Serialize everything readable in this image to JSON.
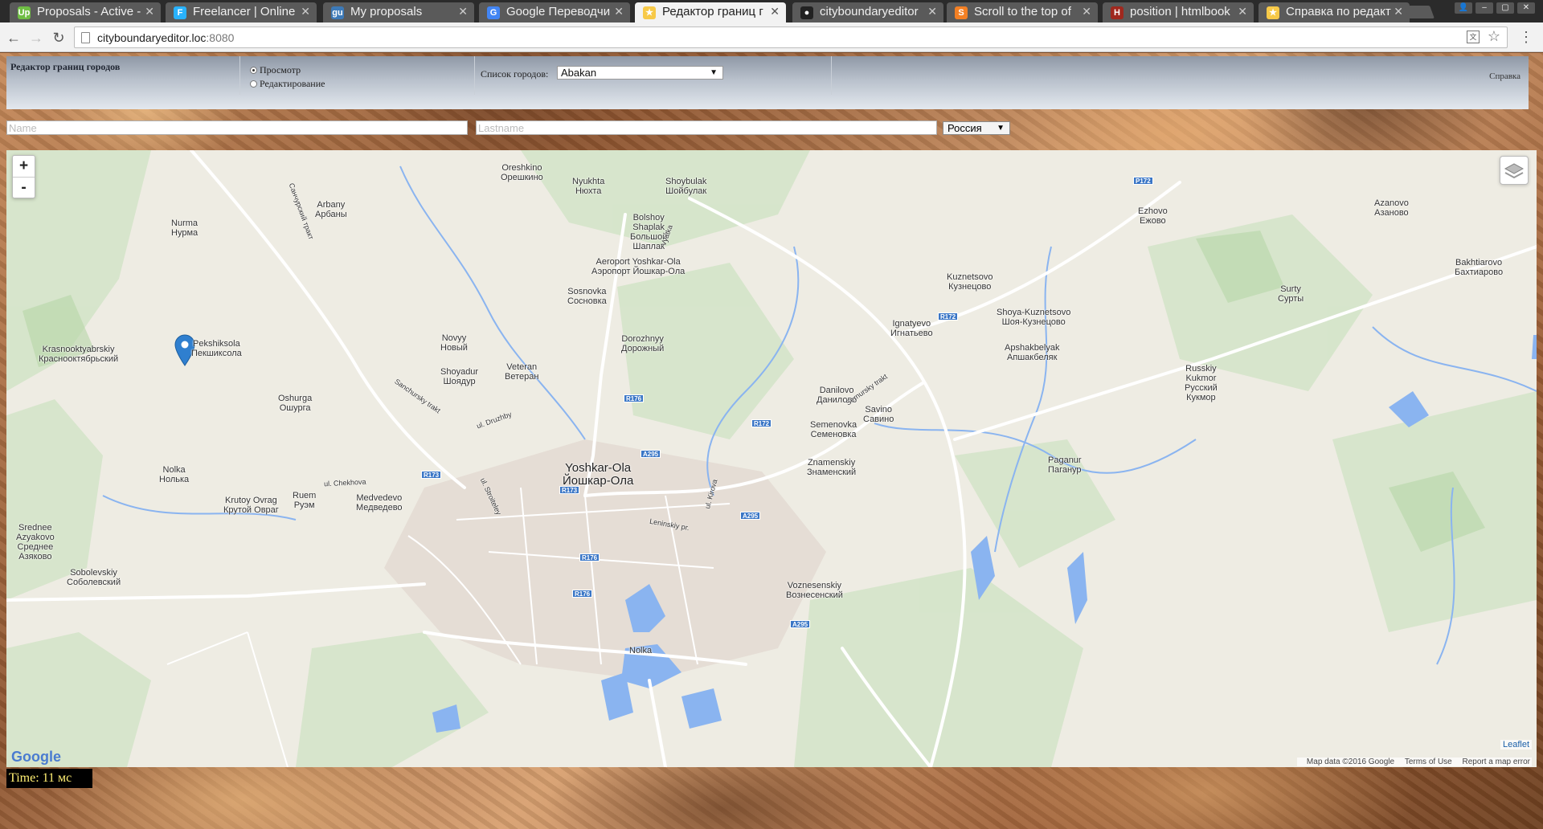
{
  "browser": {
    "tabs": [
      {
        "title": "Proposals - Active -",
        "icon": "upwork-icon",
        "color": "#6fbe44",
        "glyph": "Up"
      },
      {
        "title": "Freelancer | Online",
        "icon": "freelancer-icon",
        "color": "#29b2fe",
        "glyph": "F"
      },
      {
        "title": "My proposals",
        "icon": "guru-icon",
        "color": "#3d7ab8",
        "glyph": "gu"
      },
      {
        "title": "Google Переводчи",
        "icon": "google-translate-icon",
        "color": "#4285f4",
        "glyph": "G"
      },
      {
        "title": "Редактор границ г",
        "icon": "page-star-icon",
        "color": "#f7c948",
        "glyph": "★"
      },
      {
        "title": "cityboundaryeditor",
        "icon": "github-icon",
        "color": "#222222",
        "glyph": "●"
      },
      {
        "title": "Scroll to the top of",
        "icon": "stackoverflow-icon",
        "color": "#f48024",
        "glyph": "S"
      },
      {
        "title": "position | htmlbook",
        "icon": "htmlbook-icon",
        "color": "#a0281e",
        "glyph": "H"
      },
      {
        "title": "Справка по редакт",
        "icon": "page-star-icon",
        "color": "#f7c948",
        "glyph": "★"
      }
    ],
    "active_tab": 4,
    "url_host": "cityboundaryeditor.loc",
    "url_port": ":8080"
  },
  "header": {
    "title": "Редактор границ городов",
    "mode_view": "Просмотр",
    "mode_edit": "Редактирование",
    "city_list_label": "Список городов:",
    "city_selected": "Abakan",
    "help": "Справка"
  },
  "filters": {
    "name_placeholder": "Name",
    "lastname_placeholder": "Lastname",
    "country_selected": "Россия"
  },
  "map": {
    "zoom_in": "+",
    "zoom_out": "-",
    "labels": [
      {
        "t": "Oreshkino\nОрешкино",
        "cls": ""
      },
      {
        "t": "Nyukhta\nНюхта",
        "cls": ""
      },
      {
        "t": "Shoybulak\nШойбулак",
        "cls": ""
      },
      {
        "t": "Arbany\nАрбаны",
        "cls": ""
      },
      {
        "t": "Nurma\nНурма",
        "cls": ""
      },
      {
        "t": "Bolshoy\nShaplak\nБольшой\nШаплак",
        "cls": ""
      },
      {
        "t": "Aeroport Yoshkar-Ola\nАэропорт Йошкар-Ола",
        "cls": ""
      },
      {
        "t": "Sosnovka\nСосновка",
        "cls": ""
      },
      {
        "t": "Pekshiksola\nПекшиксола",
        "cls": ""
      },
      {
        "t": "Krasnooktyabrskiy\nКраснооктябрьский",
        "cls": ""
      },
      {
        "t": "Novyy\nНовый",
        "cls": ""
      },
      {
        "t": "Dorozhnyy\nДорожный",
        "cls": ""
      },
      {
        "t": "Veteran\nВетеран",
        "cls": ""
      },
      {
        "t": "Shoyadur\nШоядур",
        "cls": ""
      },
      {
        "t": "Oshurga\nОшурга",
        "cls": ""
      },
      {
        "t": "Yoshkar-Ola\nЙошкар-Ола",
        "cls": "big"
      },
      {
        "t": "Nolka\nНолька",
        "cls": ""
      },
      {
        "t": "Krutoy Ovrag\nКрутой Овраг",
        "cls": ""
      },
      {
        "t": "Ruem\nРуэм",
        "cls": ""
      },
      {
        "t": "Medvedevo\nМедведево",
        "cls": ""
      },
      {
        "t": "Srednee\nAzyakovo\nСреднее\nАзяково",
        "cls": ""
      },
      {
        "t": "Sobolevskiy\nСоболевский",
        "cls": ""
      },
      {
        "t": "Nolka",
        "cls": ""
      },
      {
        "t": "Ezhovo\nЕжово",
        "cls": ""
      },
      {
        "t": "Azanovo\nАзаново",
        "cls": ""
      },
      {
        "t": "Kuznetsovo\nКузнецово",
        "cls": ""
      },
      {
        "t": "Bakhtiarovo\nБахтиарово",
        "cls": ""
      },
      {
        "t": "Surty\nСурты",
        "cls": ""
      },
      {
        "t": "Ignatyevo\nИгнатьево",
        "cls": ""
      },
      {
        "t": "Shoya-Kuznetsovo\nШоя-Кузнецово",
        "cls": ""
      },
      {
        "t": "Apshakbelyak\nАпшакбеляк",
        "cls": ""
      },
      {
        "t": "Russkiy\nKukmor\nРусский\nКукмор",
        "cls": ""
      },
      {
        "t": "Danilovo\nДанилово",
        "cls": ""
      },
      {
        "t": "Savino\nСавино",
        "cls": ""
      },
      {
        "t": "Semenovka\nСеменовка",
        "cls": ""
      },
      {
        "t": "Znamenskiy\nЗнаменский",
        "cls": ""
      },
      {
        "t": "Paganur\nПаганур",
        "cls": ""
      },
      {
        "t": "Voznesenskiy\nВознесенский",
        "cls": ""
      }
    ],
    "shields": [
      "P172",
      "R172",
      "R176",
      "R172",
      "A295",
      "R173",
      "R173",
      "A295",
      "R176",
      "R176",
      "A295"
    ],
    "road_labels": [
      "Санчурский тракт",
      "Sanchursky trakt",
      "ul. Druzhby",
      "ul. Chekhova",
      "Sernursky trakt",
      "Leninskiy pr.",
      "ul. Kirova",
      "ul. Stroiteley",
      "Vyatka"
    ],
    "leaflet": "Leaflet",
    "attribution": [
      "Map data ©2016 Google",
      "Terms of Use",
      "Report a map error"
    ],
    "google": "Google"
  },
  "timer": "Time:  11 мс"
}
